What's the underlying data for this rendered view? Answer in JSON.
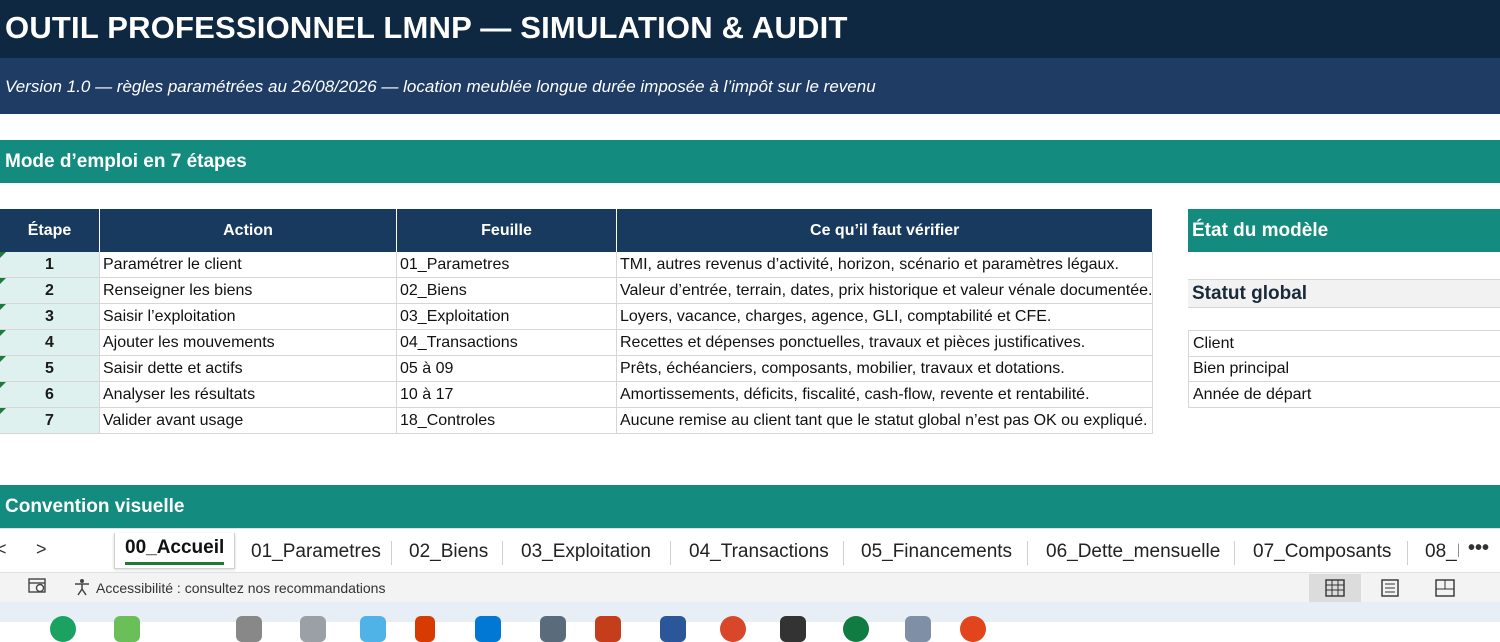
{
  "title": "OUTIL PROFESSIONNEL LMNP — SIMULATION & AUDIT",
  "subtitle": "Version 1.0 — règles paramétrées au 26/08/2026 — location meublée longue durée imposée à l’impôt sur le revenu",
  "sections": {
    "mode_emploi": "Mode d’emploi en 7 étapes",
    "convention": "Convention visuelle"
  },
  "steps_table": {
    "headers": [
      "Étape",
      "Action",
      "Feuille",
      "Ce qu’il faut vérifier"
    ],
    "rows": [
      {
        "step": "1",
        "action": "Paramétrer le client",
        "sheet": "01_Parametres",
        "check": "TMI, autres revenus d’activité, horizon, scénario et paramètres légaux."
      },
      {
        "step": "2",
        "action": "Renseigner les biens",
        "sheet": "02_Biens",
        "check": "Valeur d’entrée, terrain, dates, prix historique et valeur vénale documentée."
      },
      {
        "step": "3",
        "action": "Saisir l’exploitation",
        "sheet": "03_Exploitation",
        "check": "Loyers, vacance, charges, agence, GLI, comptabilité et CFE."
      },
      {
        "step": "4",
        "action": "Ajouter les mouvements",
        "sheet": "04_Transactions",
        "check": "Recettes et dépenses ponctuelles, travaux et pièces justificatives."
      },
      {
        "step": "5",
        "action": "Saisir dette et actifs",
        "sheet": "05 à 09",
        "check": "Prêts, échéanciers, composants, mobilier, travaux et dotations."
      },
      {
        "step": "6",
        "action": "Analyser les résultats",
        "sheet": "10 à 17",
        "check": "Amortissements, déficits, fiscalité, cash-flow, revente et rentabilité."
      },
      {
        "step": "7",
        "action": "Valider avant usage",
        "sheet": "18_Controles",
        "check": "Aucune remise au client tant que le statut global n’est pas OK ou expliqué."
      }
    ]
  },
  "etat": {
    "header": "État du modèle",
    "statut_label": "Statut global",
    "items": [
      "Client",
      "Bien principal",
      "Année de départ"
    ]
  },
  "tabs": {
    "prev": "<",
    "next": ">",
    "items": [
      "00_Accueil",
      "01_Parametres",
      "02_Biens",
      "03_Exploitation",
      "04_Transactions",
      "05_Financements",
      "06_Dette_mensuelle",
      "07_Composants",
      "08_I"
    ],
    "active": "00_Accueil",
    "more": "•••"
  },
  "statusbar": {
    "accessibility_text": "Accessibilité : consultez nos recommandations",
    "views": [
      "normal-view",
      "page-layout-view",
      "page-break-view"
    ]
  },
  "colors": {
    "title_bg": "#0e2842",
    "subtitle_bg": "#1f3c64",
    "section_bg": "#138b7e",
    "table_header_bg": "#173a5e",
    "step_cell_bg": "#dff1ee",
    "active_tab_underline": "#1e7a3a"
  }
}
